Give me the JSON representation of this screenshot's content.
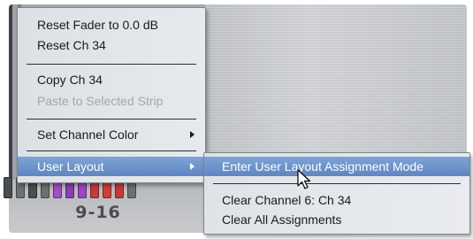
{
  "context_menu": {
    "items": [
      {
        "label": "Reset Fader to 0.0 dB",
        "enabled": true
      },
      {
        "label": "Reset Ch 34",
        "enabled": true
      },
      {
        "label": "Copy Ch 34",
        "enabled": true
      },
      {
        "label": "Paste to Selected Strip",
        "enabled": false
      },
      {
        "label": "Set Channel Color",
        "enabled": true,
        "has_submenu": true
      },
      {
        "label": "User Layout",
        "enabled": true,
        "has_submenu": true,
        "highlighted": true
      }
    ]
  },
  "user_layout_submenu": {
    "items": [
      {
        "label": "Enter User Layout Assignment Mode",
        "highlighted": true
      },
      {
        "label": "Clear Channel 6: Ch 34"
      },
      {
        "label": "Clear All Assignments"
      }
    ]
  },
  "bank": {
    "label": "9-16",
    "led_colors": [
      "#4b4d50",
      "#6e7174",
      "#4b4d50",
      "#6e7174",
      "#a24fc2",
      "#8a3fb0",
      "#9d46bf",
      "#c63a3a",
      "#d23c3c",
      "#c63a3a",
      "#6e7174"
    ]
  },
  "colors": {
    "menu_highlight": "#6f95cd",
    "disabled_text": "#a3a7ab"
  }
}
